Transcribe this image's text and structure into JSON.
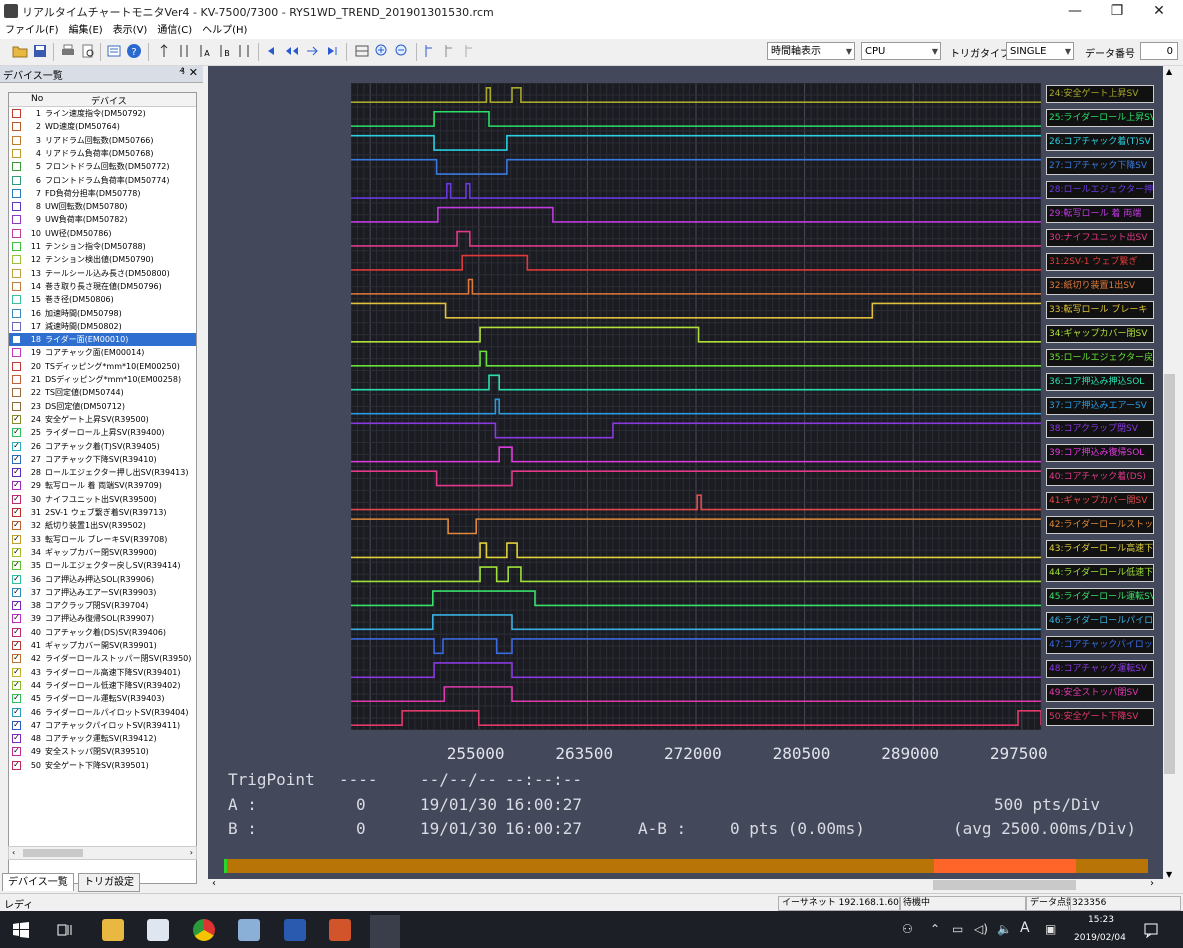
{
  "window": {
    "title": "リアルタイムチャートモニタVer4 - KV-7500/7300 - RYS1WD_TREND_201901301530.rcm",
    "minimize": "—",
    "maximize": "❐",
    "close": "✕"
  },
  "menu": [
    "ファイル(F)",
    "編集(E)",
    "表示(V)",
    "通信(C)",
    "ヘルプ(H)"
  ],
  "toolbar": {
    "view_mode": "時間軸表示",
    "device": "CPU",
    "trigger_type_label": "トリガタイプ",
    "trigger_type": "SINGLE",
    "data_no_label": "データ番号",
    "data_no": "0"
  },
  "device_panel": {
    "title": "デバイス一覧",
    "pin": "₰",
    "close": "✕",
    "col_no": "No",
    "col_device": "デバイス",
    "devices": [
      {
        "no": "1",
        "name": "ライン速度指令(DM50792)",
        "color": "#c0392b",
        "checked": false
      },
      {
        "no": "2",
        "name": "WD速度(DM50764)",
        "color": "#b65a2a",
        "checked": false
      },
      {
        "no": "3",
        "name": "リアドラム回転数(DM50766)",
        "color": "#c27c2a",
        "checked": false
      },
      {
        "no": "4",
        "name": "リアドラム負荷率(DM50768)",
        "color": "#c09a2a",
        "checked": false
      },
      {
        "no": "5",
        "name": "フロントドラム回転数(DM50772)",
        "color": "#3a9a3a",
        "checked": false
      },
      {
        "no": "6",
        "name": "フロントドラム負荷率(DM50774)",
        "color": "#2a9a7a",
        "checked": false
      },
      {
        "no": "7",
        "name": "FD負荷分担率(DM50778)",
        "color": "#2a7ac0",
        "checked": false
      },
      {
        "no": "8",
        "name": "UW回転数(DM50780)",
        "color": "#5a3ac0",
        "checked": false
      },
      {
        "no": "9",
        "name": "UW負荷率(DM50782)",
        "color": "#8a3ac0",
        "checked": false
      },
      {
        "no": "10",
        "name": "UW径(DM50786)",
        "color": "#c03a9a",
        "checked": false
      },
      {
        "no": "11",
        "name": "テンション指令(DM50788)",
        "color": "#3ac03a",
        "checked": false
      },
      {
        "no": "12",
        "name": "テンション検出値(DM50790)",
        "color": "#9ac03a",
        "checked": false
      },
      {
        "no": "13",
        "name": "テールシール込み長さ(DM50800)",
        "color": "#c0a03a",
        "checked": false
      },
      {
        "no": "14",
        "name": "巻き取り長さ現在値(DM50796)",
        "color": "#c07a3a",
        "checked": false
      },
      {
        "no": "15",
        "name": "巻き径(DM50806)",
        "color": "#3ac0a0",
        "checked": false
      },
      {
        "no": "16",
        "name": "加速時間(DM50798)",
        "color": "#3a8ac0",
        "checked": false
      },
      {
        "no": "17",
        "name": "減速時間(DM50802)",
        "color": "#6a6ac0",
        "checked": false
      },
      {
        "no": "18",
        "name": "ライダー面(EM00010)",
        "color": "#2f6fd0",
        "checked": false
      },
      {
        "no": "19",
        "name": "コアチャック面(EM00014)",
        "color": "#c03ac0",
        "checked": false
      },
      {
        "no": "20",
        "name": "TSディッピング*mm*10(EM00250)",
        "color": "#c03a3a",
        "checked": false
      },
      {
        "no": "21",
        "name": "DSディッピング*mm*10(EM00258)",
        "color": "#c0603a",
        "checked": false
      },
      {
        "no": "22",
        "name": "TS回定値(DM50744)",
        "color": "#a06a3a",
        "checked": false
      },
      {
        "no": "23",
        "name": "DS回定値(DM50712)",
        "color": "#8a6a3a",
        "checked": false
      },
      {
        "no": "24",
        "name": "安全ゲート上昇SV(R39500)",
        "color": "#8a8a2a",
        "checked": true
      },
      {
        "no": "25",
        "name": "ライダーロール上昇SV(R39400)",
        "color": "#2ac05a",
        "checked": true
      },
      {
        "no": "26",
        "name": "コアチャック着(T)SV(R39405)",
        "color": "#2ab0c0",
        "checked": true
      },
      {
        "no": "27",
        "name": "コアチャック下降SV(R39410)",
        "color": "#2a6ac0",
        "checked": true
      },
      {
        "no": "28",
        "name": "ロールエジェクター押し出SV(R39413)",
        "color": "#5a2ac0",
        "checked": true
      },
      {
        "no": "29",
        "name": "転写ロール 着 両端SV(R39709)",
        "color": "#a02ac0",
        "checked": true
      },
      {
        "no": "30",
        "name": "ナイフユニット出SV(R39500)",
        "color": "#c02a6a",
        "checked": true
      },
      {
        "no": "31",
        "name": "2SV-1 ウェブ繋ぎ着SV(R39713)",
        "color": "#c02a2a",
        "checked": true
      },
      {
        "no": "32",
        "name": "紙切り装置1出SV(R39502)",
        "color": "#c0602a",
        "checked": true
      },
      {
        "no": "33",
        "name": "転写ロール ブレーキSV(R39708)",
        "color": "#c0a02a",
        "checked": true
      },
      {
        "no": "34",
        "name": "ギャップカバー閉SV(R39900)",
        "color": "#a0c02a",
        "checked": true
      },
      {
        "no": "35",
        "name": "ロールエジェクター戻しSV(R39414)",
        "color": "#5ac02a",
        "checked": true
      },
      {
        "no": "36",
        "name": "コア押込み押込SOL(R39906)",
        "color": "#2ac0a0",
        "checked": true
      },
      {
        "no": "37",
        "name": "コア押込みエアーSV(R39903)",
        "color": "#2a8ac0",
        "checked": true
      },
      {
        "no": "38",
        "name": "コアクラップ閉SV(R39704)",
        "color": "#7a2ac0",
        "checked": true
      },
      {
        "no": "39",
        "name": "コア押込み復帰SOL(R39907)",
        "color": "#c02ac0",
        "checked": true
      },
      {
        "no": "40",
        "name": "コアチャック着(DS)SV(R39406)",
        "color": "#c02a6a",
        "checked": true
      },
      {
        "no": "41",
        "name": "ギャップカバー開SV(R39901)",
        "color": "#c03a3a",
        "checked": true
      },
      {
        "no": "42",
        "name": "ライダーロールストッパー閉SV(R3950)",
        "color": "#c0702a",
        "checked": true
      },
      {
        "no": "43",
        "name": "ライダーロール高速下降SV(R39401)",
        "color": "#c0b02a",
        "checked": true
      },
      {
        "no": "44",
        "name": "ライダーロール低速下降SV(R39402)",
        "color": "#8ac02a",
        "checked": true
      },
      {
        "no": "45",
        "name": "ライダーロール運転SV(R39403)",
        "color": "#2ac05a",
        "checked": true
      },
      {
        "no": "46",
        "name": "ライダーロールパイロットSV(R39404)",
        "color": "#2a9ac0",
        "checked": true
      },
      {
        "no": "47",
        "name": "コアチャックパイロットSV(R39411)",
        "color": "#2a5ac0",
        "checked": true
      },
      {
        "no": "48",
        "name": "コアチャック運転SV(R39412)",
        "color": "#7a2ac0",
        "checked": true
      },
      {
        "no": "49",
        "name": "安全ストッパ閉SV(R39510)",
        "color": "#c02a9a",
        "checked": true
      },
      {
        "no": "50",
        "name": "安全ゲート下降SV(R39501)",
        "color": "#c02a5a",
        "checked": true
      }
    ],
    "tab_devices": "デバイス一覧",
    "tab_trigger": "トリガ設定"
  },
  "legend": [
    {
      "label": "24:安全ゲート上昇SV",
      "color": "#a8a82a"
    },
    {
      "label": "25:ライダーロール上昇SV",
      "color": "#2ae06a"
    },
    {
      "label": "26:コアチャック着(T)SV",
      "color": "#2ad0e0"
    },
    {
      "label": "27:コアチャック下降SV",
      "color": "#3a7ae0"
    },
    {
      "label": "28:ロールエジェクター押出",
      "color": "#6a3ae0"
    },
    {
      "label": "29:転写ロール 着 両端",
      "color": "#c03ae0"
    },
    {
      "label": "30:ナイフユニット出SV",
      "color": "#e03a8a"
    },
    {
      "label": "31:2SV-1 ウェブ繋ぎ",
      "color": "#e03a3a"
    },
    {
      "label": "32:紙切り装置1出SV",
      "color": "#e07a3a"
    },
    {
      "label": "33:転写ロール ブレーキ",
      "color": "#e0c03a"
    },
    {
      "label": "34:ギャップカバー閉SV",
      "color": "#b0e03a"
    },
    {
      "label": "35:ロールエジェクター戻し",
      "color": "#6ae03a"
    },
    {
      "label": "36:コア押込み押込SOL",
      "color": "#2ae0b0"
    },
    {
      "label": "37:コア押込みエアーSV",
      "color": "#2a9ae0"
    },
    {
      "label": "38:コアクラップ閉SV",
      "color": "#8a3ae0"
    },
    {
      "label": "39:コア押込み復帰SOL",
      "color": "#e03ae0"
    },
    {
      "label": "40:コアチャック着(DS)",
      "color": "#e03a8a"
    },
    {
      "label": "41:ギャップカバー開SV",
      "color": "#e04a4a"
    },
    {
      "label": "42:ライダーロールストッパー",
      "color": "#e08a3a"
    },
    {
      "label": "43:ライダーロール高速下",
      "color": "#e0d03a"
    },
    {
      "label": "44:ライダーロール低速下",
      "color": "#a0e03a"
    },
    {
      "label": "45:ライダーロール運転SV",
      "color": "#3ae06a"
    },
    {
      "label": "46:ライダーロールパイロット",
      "color": "#3ab0e0"
    },
    {
      "label": "47:コアチャックパイロット",
      "color": "#3a6ae0"
    },
    {
      "label": "48:コアチャック運転SV",
      "color": "#8a3ae0"
    },
    {
      "label": "49:安全ストッパ閉SV",
      "color": "#e03ab0"
    },
    {
      "label": "50:安全ゲート下降SV",
      "color": "#e03a6a"
    }
  ],
  "x_ticks": [
    "255000",
    "263500",
    "272000",
    "280500",
    "289000",
    "297500"
  ],
  "info": {
    "trig_label": "TrigPoint",
    "trig_value": "----",
    "trig_date": "--/--/--",
    "trig_time": "--:--:--",
    "a_label": "A :",
    "a_value": "0",
    "a_date": "19/01/30",
    "a_time": "16:00:27",
    "b_label": "B :",
    "b_value": "0",
    "b_date": "19/01/30",
    "b_time": "16:00:27",
    "ab_label": "A-B :",
    "ab_value": "0 pts (0.00ms)",
    "div_label": "500 pts/Div",
    "avg_label": "(avg 2500.00ms/Div)"
  },
  "statusbar": {
    "ready": "レディ",
    "ethernet": "イーサネット 192.168.1.60",
    "state": "待機中",
    "points_label": "データ点数",
    "points": "323356"
  },
  "taskbar": {
    "time": "15:23",
    "date": "2019/02/04",
    "ime": "A"
  },
  "chart_data": {
    "type": "line",
    "x_ticks": [
      255000,
      263500,
      272000,
      280500,
      289000,
      297500
    ],
    "xlim": [
      245000,
      299000
    ],
    "x_per_div": 500,
    "series": [
      {
        "name": "24:安全ゲート上昇SV",
        "color": "#a8a82a",
        "base": 0,
        "pulses": [
          [
            255600,
            255900
          ],
          [
            257600,
            258300
          ]
        ]
      },
      {
        "name": "25:ライダーロール上昇SV",
        "color": "#2ae06a",
        "base": 0,
        "pulses": [
          [
            251500,
            255800
          ]
        ]
      },
      {
        "name": "26:コアチャック着(T)SV",
        "color": "#2ad0e0",
        "base": 0,
        "dips": [
          [
            251500,
            257200
          ]
        ]
      },
      {
        "name": "27:コアチャック下降SV",
        "color": "#3a7ae0",
        "base": 0,
        "dips": [
          [
            251700,
            257200
          ]
        ]
      },
      {
        "name": "28:ロールエジェクター押出",
        "color": "#6a3ae0",
        "base": 0,
        "pulses": [
          [
            252500,
            252800
          ],
          [
            254000,
            254300
          ]
        ]
      },
      {
        "name": "29:転写ロール 着 両端",
        "color": "#c03ae0",
        "base": 0,
        "pulses": [
          [
            251800,
            260800
          ]
        ]
      },
      {
        "name": "30:ナイフユニット出SV",
        "color": "#e03a8a",
        "base": 0,
        "pulses": [
          [
            253300,
            254300
          ]
        ]
      },
      {
        "name": "31:2SV-1 ウェブ繋ぎ",
        "color": "#e03a3a",
        "base": 0,
        "pulses": [
          [
            253700,
            258800
          ]
        ]
      },
      {
        "name": "32:紙切り装置1出SV",
        "color": "#e07a3a",
        "base": 0,
        "pulses": [
          [
            254200,
            254500
          ]
        ]
      },
      {
        "name": "33:転写ロール ブレーキ",
        "color": "#e0c03a",
        "base": 1,
        "dips": [
          [
            252400,
            285800
          ]
        ]
      },
      {
        "name": "34:ギャップカバー閉SV",
        "color": "#b0e03a",
        "base": 0,
        "pulses": [
          [
            255100,
            272200
          ]
        ]
      },
      {
        "name": "35:ロールエジェクター戻し",
        "color": "#6ae03a",
        "base": 0,
        "pulses": [
          [
            255100,
            255600
          ]
        ]
      },
      {
        "name": "36:コア押込み押込SOL",
        "color": "#2ae0b0",
        "base": 0,
        "pulses": [
          [
            255800,
            256600
          ]
        ]
      },
      {
        "name": "37:コア押込みエアーSV",
        "color": "#2a9ae0",
        "base": 0,
        "pulses": [
          [
            256300,
            256600
          ]
        ]
      },
      {
        "name": "38:コアクラップ閉SV",
        "color": "#8a3ae0",
        "base": 0,
        "dips": [
          [
            256300,
            265500
          ]
        ]
      },
      {
        "name": "39:コア押込み復帰SOL",
        "color": "#e03ae0",
        "base": 0,
        "pulses": [
          [
            256600,
            257600
          ]
        ]
      },
      {
        "name": "40:コアチャック着(DS)",
        "color": "#e03a8a",
        "base": 0,
        "dips": [
          [
            251700,
            257600
          ]
        ]
      },
      {
        "name": "41:ギャップカバー開SV",
        "color": "#e04a4a",
        "base": 0,
        "pulses": [
          [
            272100,
            272400
          ]
        ]
      },
      {
        "name": "42:ライダーロールストッパー",
        "color": "#e08a3a",
        "base": 0,
        "dips": [
          [
            252600,
            254800
          ]
        ]
      },
      {
        "name": "43:ライダーロール高速下",
        "color": "#e0d03a",
        "base": 0,
        "pulses": [
          [
            255100,
            255600
          ],
          [
            257200,
            258000
          ]
        ]
      },
      {
        "name": "44:ライダーロール低速下",
        "color": "#a0e03a",
        "base": 0,
        "pulses": [
          [
            255100,
            256400
          ],
          [
            257300,
            258300
          ]
        ]
      },
      {
        "name": "45:ライダーロール運転SV",
        "color": "#3ae06a",
        "base": 0,
        "pulses": [
          [
            251400,
            259400
          ]
        ]
      },
      {
        "name": "46:ライダーロールパイロット",
        "color": "#3ab0e0",
        "base": 0,
        "pulses": [
          [
            251400,
            257600
          ]
        ]
      },
      {
        "name": "47:コアチャックパイロット",
        "color": "#3a6ae0",
        "base": 0,
        "dips": [
          [
            251500,
            252200
          ],
          [
            256400,
            257600
          ]
        ]
      },
      {
        "name": "48:コアチャック運転SV",
        "color": "#8a3ae0",
        "base": 0,
        "pulses": [
          [
            251500,
            257600
          ]
        ]
      },
      {
        "name": "49:安全ストッパ閉SV",
        "color": "#e03ab0",
        "base": 0,
        "pulses": [
          [
            252300,
            257600
          ]
        ]
      },
      {
        "name": "50:安全ゲート下降SV",
        "color": "#e03a6a",
        "base": 0,
        "pulses": [
          [
            249000,
            255000
          ],
          [
            297200,
            299000
          ]
        ]
      }
    ]
  }
}
